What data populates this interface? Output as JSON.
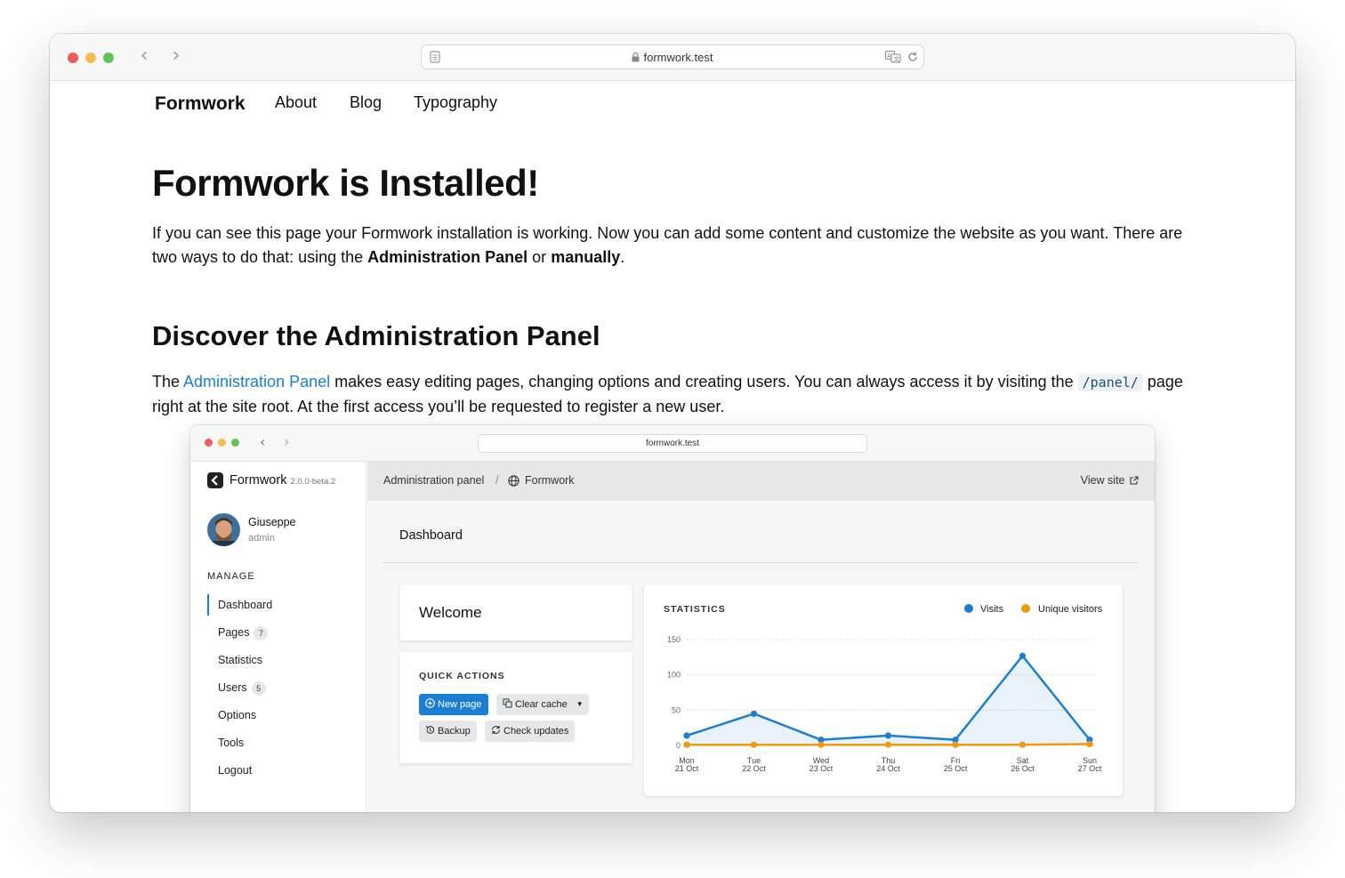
{
  "browser": {
    "url": "formwork.test",
    "traffic_lights": [
      "#ed5f57",
      "#f5bd4f",
      "#61c454"
    ]
  },
  "site_nav": {
    "brand": "Formwork",
    "links": [
      "About",
      "Blog",
      "Typography"
    ]
  },
  "page": {
    "title": "Formwork is Installed!",
    "intro_p1": "If you can see this page your Formwork installation is working. Now you can add some content and customize the website as you want. There are two ways to do that: using the ",
    "intro_b1": "Administration Panel",
    "intro_p2": " or ",
    "intro_b2": "manually",
    "intro_p3": ".",
    "section_title": "Discover the Administration Panel",
    "sec_p1": "The ",
    "sec_link": "Administration Panel",
    "sec_p2": " makes easy editing pages, changing options and creating users. You can always access it by visiting the ",
    "sec_code": "/panel/",
    "sec_p3": " page right at the site root. At the first access you’ll be requested to register a new user."
  },
  "admin": {
    "url": "formwork.test",
    "brand": "Formwork",
    "version": "2.0.0-beta.2",
    "user_name": "Giuseppe",
    "user_role": "admin",
    "manage_heading": "MANAGE",
    "menu": [
      {
        "label": "Dashboard",
        "badge": ""
      },
      {
        "label": "Pages",
        "badge": "7"
      },
      {
        "label": "Statistics",
        "badge": ""
      },
      {
        "label": "Users",
        "badge": "5"
      },
      {
        "label": "Options",
        "badge": ""
      },
      {
        "label": "Tools",
        "badge": ""
      },
      {
        "label": "Logout",
        "badge": ""
      }
    ],
    "crumb_panel": "Administration panel",
    "crumb_sep": "/",
    "crumb_site": "Formwork",
    "view_site": "View site",
    "dashboard_title": "Dashboard",
    "welcome": "Welcome",
    "quick_actions": "QUICK ACTIONS",
    "buttons": {
      "new_page": "New page",
      "clear_cache": "Clear cache",
      "backup": "Backup",
      "check_updates": "Check updates"
    },
    "accent": "#1a7fd4"
  },
  "chart_data": {
    "type": "line",
    "title": "STATISTICS",
    "categories": [
      "Mon 21 Oct",
      "Tue 22 Oct",
      "Wed 23 Oct",
      "Thu 24 Oct",
      "Fri 25 Oct",
      "Sat 26 Oct",
      "Sun 27 Oct"
    ],
    "category_lines": [
      [
        "Mon",
        "21 Oct"
      ],
      [
        "Tue",
        "22 Oct"
      ],
      [
        "Wed",
        "23 Oct"
      ],
      [
        "Thu",
        "24 Oct"
      ],
      [
        "Fri",
        "25 Oct"
      ],
      [
        "Sat",
        "26 Oct"
      ],
      [
        "Sun",
        "27 Oct"
      ]
    ],
    "series": [
      {
        "name": "Visits",
        "color": "#1a7fd4",
        "values": [
          14,
          45,
          8,
          14,
          8,
          127,
          8
        ]
      },
      {
        "name": "Unique visitors",
        "color": "#f29a0f",
        "values": [
          1,
          1,
          1,
          1,
          1,
          1,
          2
        ]
      }
    ],
    "yticks": [
      0,
      50,
      100,
      150
    ],
    "ylim": [
      0,
      150
    ],
    "grid": true,
    "legend": "top-right"
  }
}
